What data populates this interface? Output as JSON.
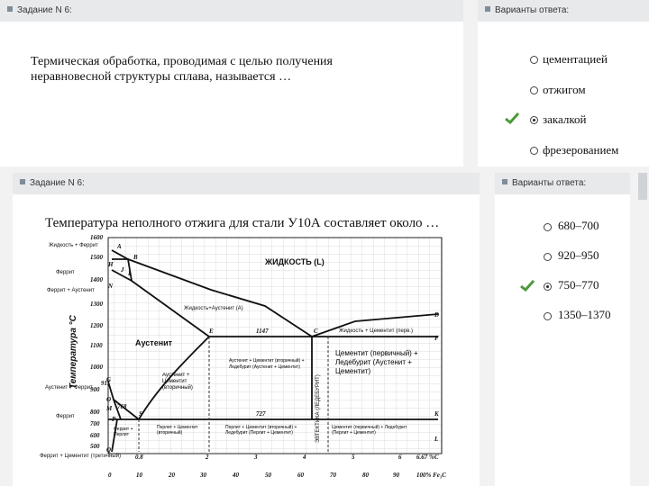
{
  "top": {
    "header": "Задание N 6:",
    "question": "Термическая обработка, проводимая с целью получения неравновесной структуры сплава, называется …",
    "answers_header": "Варианты ответа:",
    "options": [
      {
        "label": "цементацией",
        "selected": false
      },
      {
        "label": "отжигом",
        "selected": false
      },
      {
        "label": "закалкой",
        "selected": true
      },
      {
        "label": "фрезерованием",
        "selected": false
      }
    ]
  },
  "bottom": {
    "header": "Задание N 6:",
    "question": "Температура неполного отжига для стали У10А составляет около …",
    "answers_header": "Варианты ответа:",
    "options": [
      {
        "label": "680–700",
        "selected": false
      },
      {
        "label": "920–950",
        "selected": false
      },
      {
        "label": "750–770",
        "selected": true
      },
      {
        "label": "1350–1370",
        "selected": false
      }
    ]
  },
  "diagram": {
    "y_axis_label": "Температура °С",
    "y_ticks": [
      "1600",
      "1500",
      "1400",
      "1300",
      "1200",
      "1100",
      "1000",
      "900",
      "800",
      "700",
      "600",
      "500"
    ],
    "x_ticks_bottom": [
      "0",
      "10",
      "20",
      "30",
      "40",
      "50",
      "60",
      "70",
      "80",
      "90",
      "100% Fe₃C"
    ],
    "x_ticks_c": [
      "0.8",
      "2",
      "3",
      "4",
      "5",
      "6",
      "6.67 %С"
    ],
    "temps": [
      "1147",
      "911",
      "768",
      "727"
    ],
    "points": [
      "A",
      "B",
      "H",
      "I",
      "N",
      "J",
      "E",
      "C",
      "D",
      "F",
      "G",
      "P",
      "S",
      "K",
      "M",
      "O",
      "Q",
      "L"
    ],
    "regions": {
      "liquid": "ЖИДКОСТЬ (L)",
      "liquid_austenite": "Жидкость+Аустенит (А)",
      "liquid_cementite": "Жидкость + Цементит (перв.)",
      "austenite": "Аустенит",
      "austenite_cementite2": "Аустенит + Цементит (вторичный)",
      "a_c2_ledeburite": "Аустенит + Цементит (вторичный) + Ледебурит (Аустенит + Цементит)",
      "eutectic": "ЭВТЕКТИКА (ЛЕДЕБУРИТ)",
      "c1_ledeburite": "Цементит (первичный) + Ледебурит (Аустенит + Цементит)",
      "p_c2": "Перлит + Цементит (вторичный)",
      "p_c2_ledeburite": "Перлит + Цементит (вторичный) + Ледебурит (Перлит + Цементит)",
      "c1_ledeburite_low": "Цементит (первичный) + Ледебурит (Перлит + Цементит)",
      "ferrite_pearlite": "Феррит + Перлит",
      "austenite_ferrite": "Аустенит + Феррит"
    },
    "left_labels": [
      "Жидкость + Феррит",
      "Феррит",
      "Феррит + Аустенит",
      "Аустенит + Феррит",
      "Феррит",
      "Феррит + Цементит (третичный)"
    ]
  }
}
